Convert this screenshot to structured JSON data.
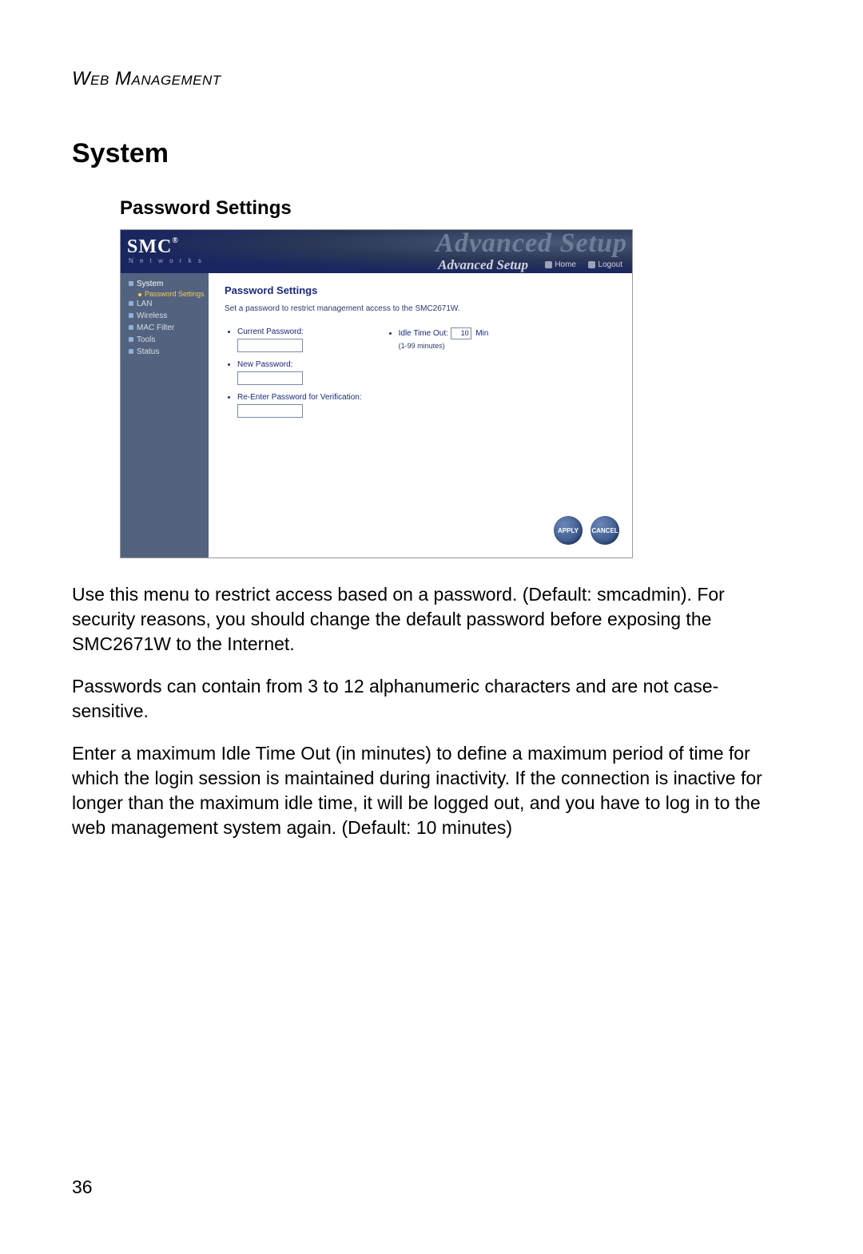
{
  "doc": {
    "header": "Web Management",
    "h1": "System",
    "h2": "Password Settings",
    "page_number": "36",
    "paragraphs": [
      "Use this menu to restrict access based on a password. (Default: smcadmin). For security reasons, you should change the default password before exposing the SMC2671W to the Internet.",
      "Passwords can contain from 3 to 12 alphanumeric characters and are not case-sensitive.",
      "Enter a maximum Idle Time Out (in minutes) to define a maximum period of time for which the login session is maintained during inactivity. If the connection is inactive for longer than the maximum idle time, it will be logged out, and you have to log in to the web management system again. (Default: 10 minutes)"
    ]
  },
  "shot": {
    "logo_main": "SMC",
    "logo_reg": "®",
    "logo_sub": "N e t w o r k s",
    "adv_ghost": "Advanced Setup",
    "adv_label": "Advanced Setup",
    "home": "Home",
    "logout": "Logout",
    "sidebar": [
      "System",
      "LAN",
      "Wireless",
      "MAC Filter",
      "Tools",
      "Status"
    ],
    "sidebar_sub": "Password Settings",
    "panel_title": "Password Settings",
    "panel_desc": "Set a password to restrict management access to the SMC2671W.",
    "fields": {
      "current": "Current Password:",
      "new": "New Password:",
      "confirm": "Re-Enter Password for Verification:"
    },
    "timeout_label": "Idle Time Out:",
    "timeout_value": "10",
    "timeout_unit": "Min",
    "timeout_hint": "(1-99 minutes)",
    "apply": "APPLY",
    "cancel": "CANCEL"
  }
}
